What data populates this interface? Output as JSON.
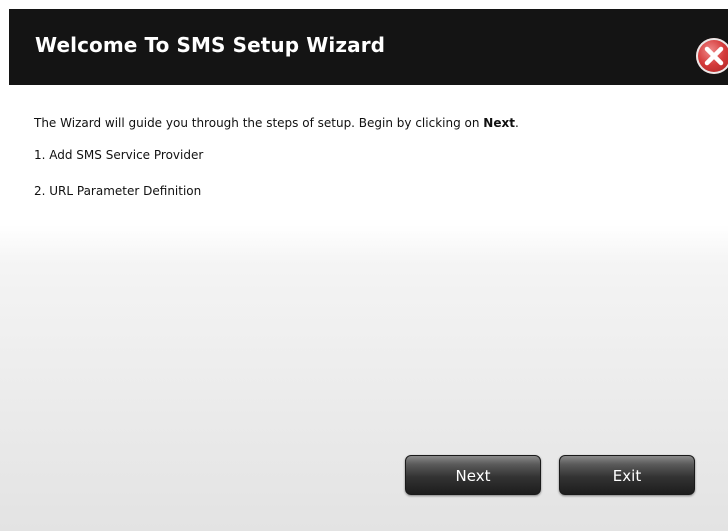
{
  "dialog": {
    "title": "Welcome To SMS Setup Wizard",
    "close_icon": "close-x-icon",
    "intro_prefix": "The Wizard will guide you through the steps of setup. Begin by clicking on ",
    "intro_bold": "Next",
    "intro_suffix": ".",
    "steps": [
      "1. Add SMS Service Provider",
      "2. URL Parameter Definition"
    ],
    "buttons": {
      "next_label": "Next",
      "exit_label": "Exit"
    }
  },
  "colors": {
    "titlebar": "#141414",
    "close_button": "#d43a3a",
    "button_dark": "#333333"
  }
}
